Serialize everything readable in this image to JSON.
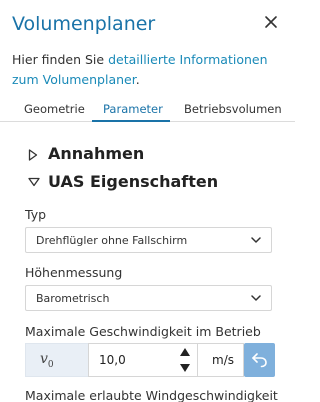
{
  "header": {
    "title": "Volumenplaner",
    "close_icon": "close-icon"
  },
  "intro": {
    "prefix": "Hier finden Sie ",
    "link_text": "detaillierte Informationen zum Volumenplaner",
    "suffix": "."
  },
  "tabs": [
    {
      "label": "Geometrie",
      "active": false
    },
    {
      "label": "Parameter",
      "active": true
    },
    {
      "label": "Betriebsvolumen",
      "active": false
    }
  ],
  "sections": [
    {
      "label": "Annahmen",
      "expanded": false,
      "icon": "triangle-right-icon"
    },
    {
      "label": "UAS Eigenschaften",
      "expanded": true,
      "icon": "triangle-down-icon"
    }
  ],
  "fields": {
    "typ": {
      "label": "Typ",
      "value": "Drehflügler ohne Fallschirm"
    },
    "hoehenmessung": {
      "label": "Höhenmessung",
      "value": "Barometrisch"
    },
    "vmax": {
      "label": "Maximale Geschwindigkeit im Betrieb",
      "symbol": "v",
      "symbol_sub": "0",
      "value": "10,0",
      "unit": "m/s"
    },
    "wind": {
      "label": "Maximale erlaubte Windgeschwindigkeit"
    }
  },
  "colors": {
    "accent": "#1a73a8",
    "link": "#1a8ab8",
    "reset_button": "#7fb0dc",
    "symbol_bg": "#e9eff6"
  }
}
